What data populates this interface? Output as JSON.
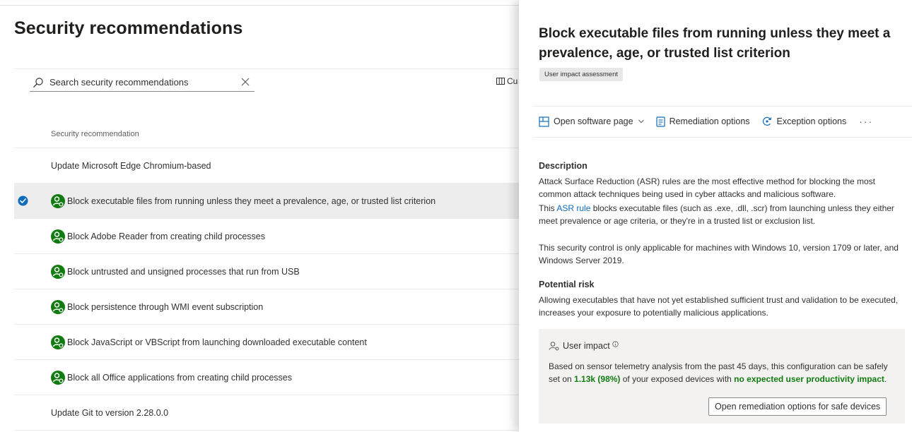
{
  "list": {
    "title": "Security recommendations",
    "search": {
      "placeholder": "Search security recommendations"
    },
    "customize_label": "Cu",
    "column_header": "Security recommendation",
    "rows": [
      {
        "label": "Update Microsoft Edge Chromium-based",
        "has_impact_icon": false,
        "selected": false
      },
      {
        "label": "Block executable files from running unless they meet a prevalence, age, or trusted list criterion",
        "has_impact_icon": true,
        "selected": true
      },
      {
        "label": "Block Adobe Reader from creating child processes",
        "has_impact_icon": true,
        "selected": false
      },
      {
        "label": "Block untrusted and unsigned processes that run from USB",
        "has_impact_icon": true,
        "selected": false
      },
      {
        "label": "Block persistence through WMI event subscription",
        "has_impact_icon": true,
        "selected": false
      },
      {
        "label": "Block JavaScript or VBScript from launching downloaded executable content",
        "has_impact_icon": true,
        "selected": false
      },
      {
        "label": "Block all Office applications from creating child processes",
        "has_impact_icon": true,
        "selected": false
      },
      {
        "label": "Update Git to version 2.28.0.0",
        "has_impact_icon": false,
        "selected": false
      }
    ]
  },
  "panel": {
    "title": "Block executable files from running unless they meet a prevalence, age, or trusted list criterion",
    "badge": "User impact assessment",
    "toolbar": {
      "open_software": "Open software page",
      "remediation": "Remediation options",
      "exception": "Exception options",
      "more": "···"
    },
    "description": {
      "heading": "Description",
      "p1": "Attack Surface Reduction (ASR) rules are the most effective method for blocking the most common attack techniques being used in cyber attacks and malicious software.",
      "p2_prefix": "This ",
      "p2_link": "ASR rule",
      "p2_suffix": " blocks executable files (such as .exe, .dll, .scr) from launching unless they either meet prevalence or age criteria, or they're in a trusted list or exclusion list.",
      "p3": "This security control is only applicable for machines with Windows 10, version 1709 or later, and Windows Server 2019."
    },
    "risk": {
      "heading": "Potential risk",
      "text": "Allowing executables that have not yet established sufficient trust and validation to be executed, increases your exposure to potentially malicious applications."
    },
    "user_impact": {
      "title": "User impact",
      "text_prefix": "Based on sensor telemetry analysis from the past 45 days, this configuration can be safely set on ",
      "count": "1.13k (98%)",
      "text_mid": " of your exposed devices with ",
      "highlight": "no expected user productivity impact",
      "text_end": ".",
      "button": "Open remediation options for safe devices"
    }
  },
  "colors": {
    "accent": "#0f6cbd",
    "impact_green": "#107c10",
    "icon_green": "#107c10",
    "selected_row": "#ededed"
  }
}
